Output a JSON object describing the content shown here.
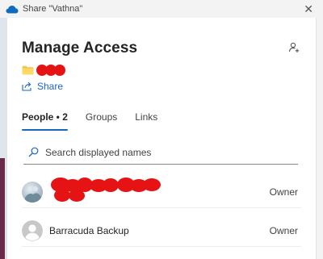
{
  "window": {
    "title": "Share \"Vathna\"",
    "close_glyph": "✕"
  },
  "panel": {
    "heading": "Manage Access",
    "share_label": "Share",
    "tabs": [
      {
        "label": "People • 2",
        "active": true
      },
      {
        "label": "Groups",
        "active": false
      },
      {
        "label": "Links",
        "active": false
      }
    ],
    "search": {
      "placeholder": "Search displayed names",
      "value": ""
    },
    "people": [
      {
        "name": "",
        "role": "Owner",
        "avatar": "photo",
        "name_redacted": true
      },
      {
        "name": "Barracuda Backup",
        "role": "Owner",
        "avatar": "generic-person"
      }
    ]
  },
  "icons": {
    "title": "onedrive-cloud-icon",
    "add_person": "person-add-icon",
    "folder": "folder-icon",
    "share": "share-icon",
    "search": "search-icon"
  },
  "colors": {
    "accent": "#1967c2",
    "folder": "#f2c74c",
    "redaction": "#e51313"
  }
}
